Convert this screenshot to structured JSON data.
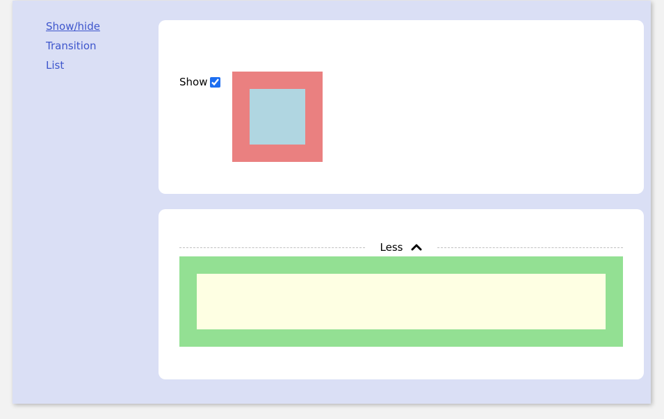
{
  "sidebar": {
    "items": [
      {
        "label": "Show/hide"
      },
      {
        "label": "Transition"
      },
      {
        "label": "List"
      }
    ]
  },
  "card1": {
    "show_label": "Show",
    "show_checked": true
  },
  "card2": {
    "toggle_label": "Less"
  }
}
